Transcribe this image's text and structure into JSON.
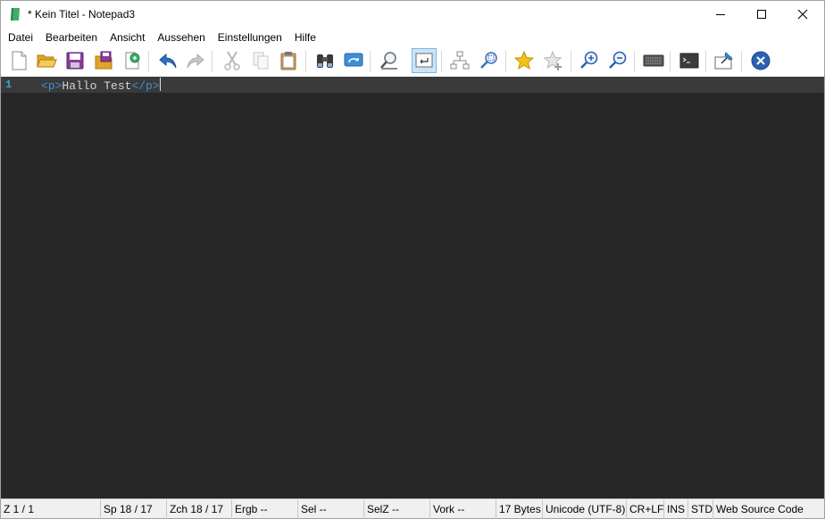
{
  "window": {
    "title": "* Kein Titel - Notepad3"
  },
  "menu": [
    "Datei",
    "Bearbeiten",
    "Ansicht",
    "Aussehen",
    "Einstellungen",
    "Hilfe"
  ],
  "toolbar": {
    "icons": [
      "new-file-icon",
      "open-folder-icon",
      "save-icon",
      "save-as-icon",
      "reload-icon",
      "undo-icon",
      "redo-icon",
      "cut-icon",
      "copy-icon",
      "paste-icon",
      "find-icon",
      "replace-icon",
      "find-zoom-icon",
      "word-wrap-icon",
      "hierarchy-icon",
      "select-zoom-icon",
      "favorite-star-icon",
      "add-favorite-icon",
      "zoom-in-icon",
      "zoom-out-icon",
      "keyboard-icon",
      "console-icon",
      "pin-icon",
      "close-circle-icon"
    ],
    "active": "word-wrap-icon"
  },
  "editor": {
    "line_number": "1",
    "tag_open": "<p>",
    "text": "Hallo Test",
    "tag_close": "</p>",
    "colors": {
      "background": "#272727",
      "current_line": "#3a3a3a",
      "tag": "#3d8fd1",
      "text": "#d4d4d4",
      "line_number": "#2aa9d4"
    }
  },
  "statusbar": {
    "line": "Z  1 / 1",
    "column": "Sp  18 / 17",
    "char": "Zch  18 / 17",
    "result": "Ergb  --",
    "selection": "Sel  --",
    "sel_lines": "SelZ  --",
    "occurrences": "Vork  --",
    "size": "17 Bytes",
    "encoding": "Unicode (UTF-8)",
    "eol": "CR+LF",
    "insert_mode": "INS",
    "mode": "STD",
    "lexer": "Web Source Code"
  }
}
